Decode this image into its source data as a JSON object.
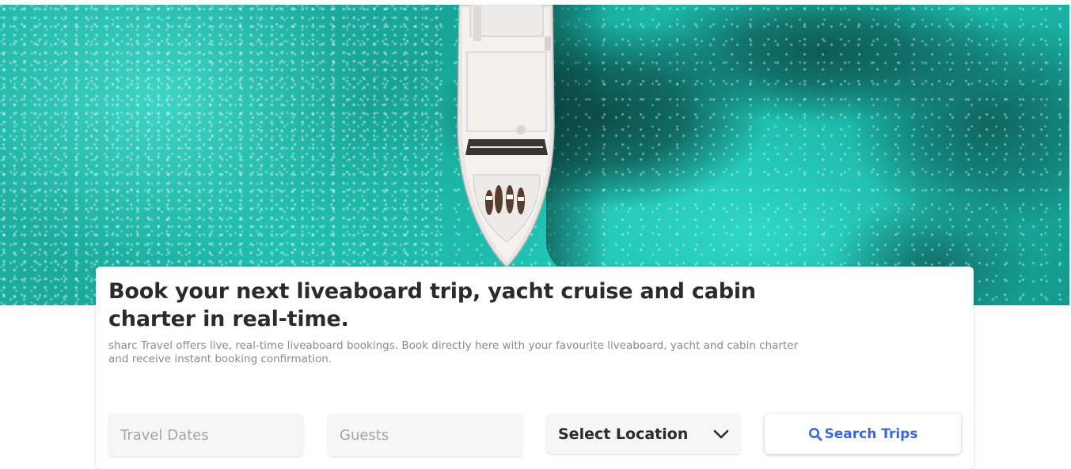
{
  "hero": {
    "image_description_icon": "yacht-aerial-hero-image"
  },
  "card": {
    "headline": "Book your next liveaboard trip, yacht cruise and cabin charter in real-time.",
    "subtitle": "sharc Travel offers live, real-time liveaboard bookings. Book directly here with your favourite liveaboard, yacht and cabin charter and receive instant booking confirmation."
  },
  "search": {
    "dates_placeholder": "Travel Dates",
    "guests_placeholder": "Guests",
    "location_selected": "Select Location",
    "location_icon": "chevron-down-icon",
    "button_label": "Search Trips",
    "button_icon": "search-icon"
  },
  "colors": {
    "accent": "#3b67e1",
    "headline": "#2b2b2b",
    "subtitle": "#8a8a8a",
    "field_bg": "#f6f6f6",
    "placeholder": "#a5a5a5"
  }
}
